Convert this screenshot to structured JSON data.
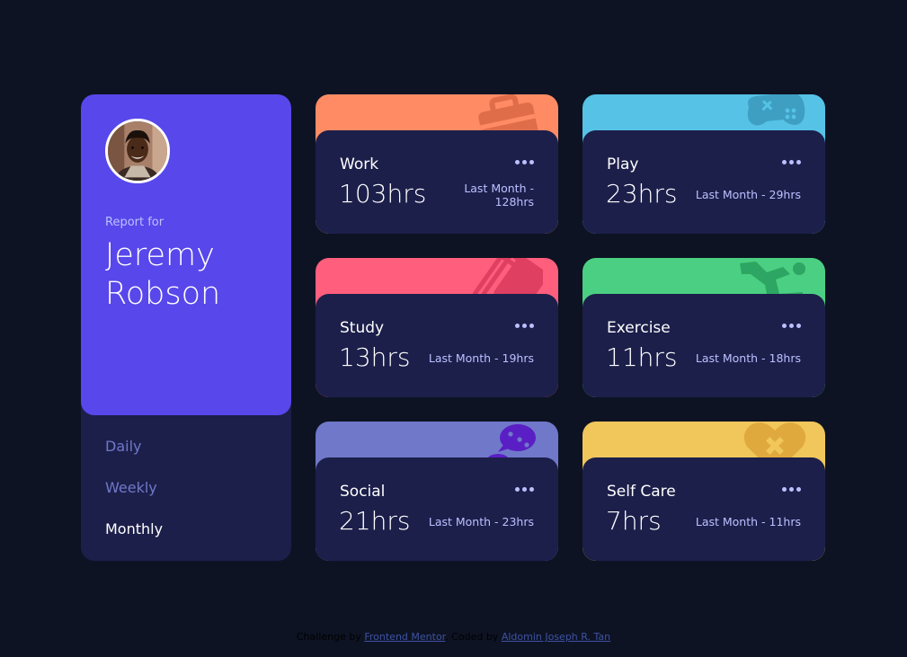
{
  "profile": {
    "report_label": "Report for",
    "name": "Jeremy Robson",
    "avatar_icon": "user-avatar-photo"
  },
  "periods": [
    {
      "label": "Daily",
      "active": false
    },
    {
      "label": "Weekly",
      "active": false
    },
    {
      "label": "Monthly",
      "active": true
    }
  ],
  "activities": [
    {
      "title": "Work",
      "current": "103hrs",
      "previous": "Last Month - 128hrs",
      "color": "#ff8b64",
      "icon": "briefcase-icon"
    },
    {
      "title": "Play",
      "current": "23hrs",
      "previous": "Last Month - 29hrs",
      "color": "#55c2e6",
      "icon": "game-controller-icon"
    },
    {
      "title": "Study",
      "current": "13hrs",
      "previous": "Last Month - 19hrs",
      "color": "#ff5e7d",
      "icon": "books-icon"
    },
    {
      "title": "Exercise",
      "current": "11hrs",
      "previous": "Last Month - 18hrs",
      "color": "#4bcf82",
      "icon": "running-figure-icon"
    },
    {
      "title": "Social",
      "current": "21hrs",
      "previous": "Last Month - 23hrs",
      "color": "#7335d2",
      "icon": "chat-bubbles-icon"
    },
    {
      "title": "Self Care",
      "current": "7hrs",
      "previous": "Last Month - 11hrs",
      "color": "#f1c75b",
      "icon": "heart-bandage-icon"
    }
  ],
  "card_colors": {
    "work": "#ff8b64",
    "play": "#55c2e6",
    "study": "#ff5e7d",
    "exercise": "#4bcf82",
    "social": "#7078c9",
    "self_care": "#f1c75b"
  },
  "footer": {
    "challenge_prefix": "Challenge by",
    "challenge_link": "Frontend Mentor",
    "coded_prefix": ". Coded by",
    "coded_link": "Aldomin Joseph R. Tan"
  }
}
